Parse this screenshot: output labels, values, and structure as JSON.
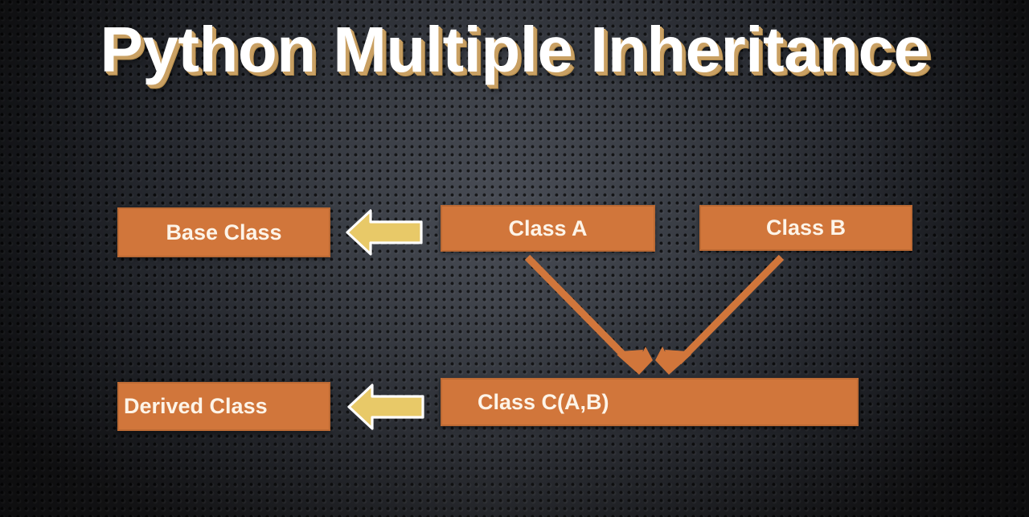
{
  "slide": {
    "title": "Python Multiple Inheritance",
    "background_style": "dark perforated metal texture",
    "colors": {
      "box_fill": "#d1763b",
      "box_border": "#bc6a34",
      "box_text": "#fdf4e8",
      "title_text": "#ffffff",
      "title_shadow": "#c9a063",
      "gold_arrow_fill": "#e8c968",
      "gold_arrow_outline": "#ffffff",
      "connector_arrow": "#d1763b",
      "background_center": "#42464f",
      "background_edge": "#141416"
    }
  },
  "diagram": {
    "boxes": [
      {
        "id": "base-class",
        "label": "Base Class",
        "role": "label",
        "align": "center"
      },
      {
        "id": "class-a",
        "label": "Class A",
        "role": "parent",
        "align": "center"
      },
      {
        "id": "class-b",
        "label": "Class B",
        "role": "parent",
        "align": "center"
      },
      {
        "id": "derived-class",
        "label": "Derived Class",
        "role": "label",
        "align": "lead"
      },
      {
        "id": "class-c",
        "label": "Class C(A,B)",
        "role": "child",
        "align": "lead"
      }
    ],
    "gold_arrows": [
      {
        "id": "base-class-pointer",
        "icon": "left-block-arrow-icon",
        "points_to": "Base Class"
      },
      {
        "id": "derived-class-pointer",
        "icon": "left-block-arrow-icon",
        "points_to": "Derived Class"
      }
    ],
    "connectors": [
      {
        "id": "class-a-to-class-c",
        "from": "Class A",
        "to": "Class C(A,B)",
        "icon": "inheritance-arrow-icon"
      },
      {
        "id": "class-b-to-class-c",
        "from": "Class B",
        "to": "Class C(A,B)",
        "icon": "inheritance-arrow-icon"
      }
    ]
  }
}
